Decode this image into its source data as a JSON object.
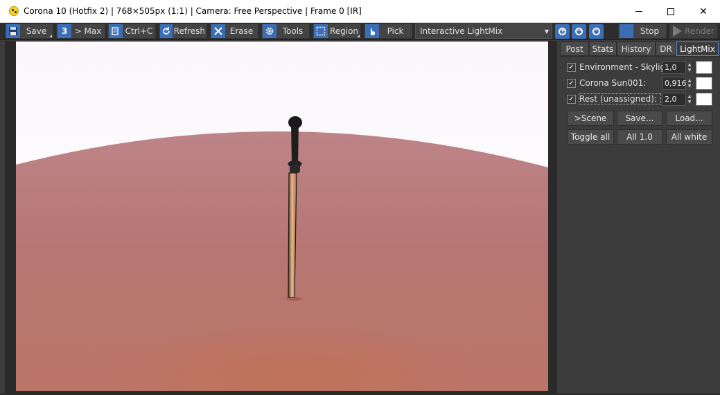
{
  "window": {
    "title": "Corona 10 (Hotfix 2) | 768×505px (1:1) | Camera: Free Perspective | Frame 0 [IR]",
    "minimize": "",
    "maximize": "",
    "close": "✕"
  },
  "toolbar": {
    "save": "Save",
    "to_max": "> Max",
    "to_max_icon": "3",
    "copy": "Ctrl+C",
    "refresh": "Refresh",
    "erase": "Erase",
    "tools": "Tools",
    "region": "Region",
    "pick": "Pick",
    "display_mode": "Interactive LightMix",
    "stop": "Stop",
    "render": "Render"
  },
  "tabs": [
    "Post",
    "Stats",
    "History",
    "DR",
    "LightMix"
  ],
  "active_tab": "LightMix",
  "lightmix": {
    "rows": [
      {
        "name": "Environment - Skylight",
        "value": "1,0",
        "checked": true,
        "color": "#ffffff"
      },
      {
        "name": "Corona Sun001:",
        "value": "0,916",
        "checked": true,
        "color": "#ffffff"
      },
      {
        "name": "Rest (unassigned):",
        "value": "2,0",
        "checked": true,
        "color": "#ffffff"
      }
    ],
    "buttons_row1": [
      ">Scene",
      "Save...",
      "Load..."
    ],
    "buttons_row2": [
      "Toggle all",
      "All 1.0",
      "All white"
    ]
  },
  "colors": {
    "accent": "#3a6fb7",
    "panel_bg": "#3c3c3c",
    "ground": "#b87470",
    "sky": "#ffffff"
  }
}
